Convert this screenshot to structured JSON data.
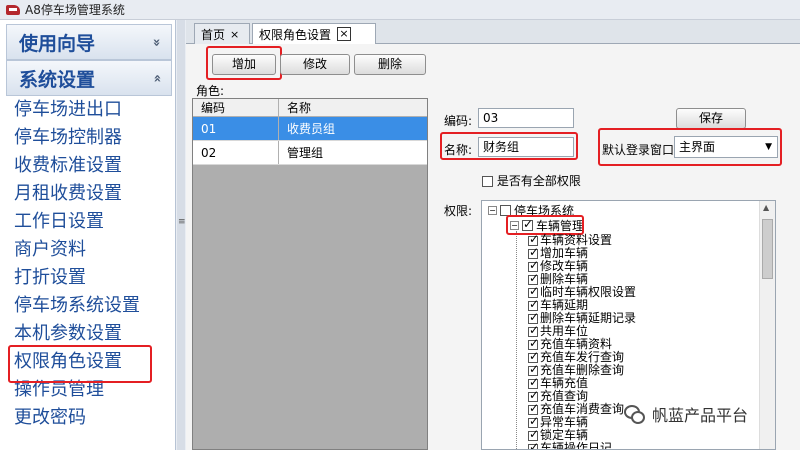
{
  "window": {
    "title": "A8停车场管理系统"
  },
  "sidebar": {
    "groups": [
      {
        "label": "使用向导",
        "chevron": "«"
      },
      {
        "label": "系统设置",
        "chevron": "«"
      }
    ],
    "items": [
      {
        "label": "停车场进出口"
      },
      {
        "label": "停车场控制器"
      },
      {
        "label": "收费标准设置"
      },
      {
        "label": "月租收费设置"
      },
      {
        "label": "工作日设置"
      },
      {
        "label": "商户资料"
      },
      {
        "label": "打折设置"
      },
      {
        "label": "停车场系统设置"
      },
      {
        "label": "本机参数设置"
      },
      {
        "label": "权限角色设置"
      },
      {
        "label": "操作员管理"
      },
      {
        "label": "更改密码"
      }
    ]
  },
  "tabs": [
    {
      "label": "首页",
      "close": "×"
    },
    {
      "label": "权限角色设置",
      "close": "×"
    }
  ],
  "toolbar": {
    "add_label": "增加",
    "edit_label": "修改",
    "delete_label": "删除"
  },
  "roles": {
    "label": "角色:",
    "columns": [
      "编码",
      "名称"
    ],
    "rows": [
      {
        "code": "01",
        "name": "收费员组"
      },
      {
        "code": "02",
        "name": "管理组"
      }
    ]
  },
  "form": {
    "code_label": "编码:",
    "code_value": "03",
    "name_label": "名称:",
    "name_value": "财务组",
    "save_label": "保存",
    "login_window_label": "默认登录窗口:",
    "login_window_value": "主界面",
    "all_perm_label": "是否有全部权限",
    "perm_label": "权限:"
  },
  "tree": {
    "root": "停车场系统",
    "node": "车辆管理",
    "leaves": [
      "车辆资料设置",
      "增加车辆",
      "修改车辆",
      "删除车辆",
      "临时车辆权限设置",
      "车辆延期",
      "删除车辆延期记录",
      "共用车位",
      "充值车辆资料",
      "充值车发行查询",
      "充值车删除查询",
      "车辆充值",
      "充值查询",
      "充值车消费查询",
      "异常车辆",
      "锁定车辆",
      "车辆操作日记"
    ]
  },
  "watermark": {
    "text": "帆蓝产品平台",
    "icon": "wechat-icon"
  },
  "colors": {
    "accent": "#1f4e9a",
    "highlight": "#e41f23",
    "selected_row": "#3a8ee6"
  }
}
